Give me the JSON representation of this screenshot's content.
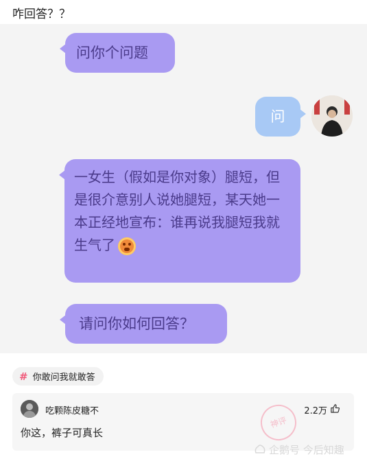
{
  "post": {
    "title": "咋回答？？"
  },
  "chat": {
    "messages": [
      {
        "text": "问你个问题"
      },
      {
        "text": "问"
      },
      {
        "text": "一女生（假如是你对象）腿短，但是很介意别人说她腿短，某天她一本正经地宣布：谁再说我腿短我就生气了"
      },
      {
        "text": "请问你如何回答？"
      }
    ]
  },
  "topic": {
    "label": "你敢问我就敢答"
  },
  "comment": {
    "username": "吃颗陈皮糖不",
    "likes": "2.2万",
    "text": "你这，裤子可真长"
  },
  "watermark": {
    "seal": "神评",
    "text": "企鹅号 今后知趣"
  },
  "colors": {
    "left_bubble": "#a99af2",
    "right_bubble": "#a8c9f5",
    "topic_hash": "#f05a7a"
  }
}
